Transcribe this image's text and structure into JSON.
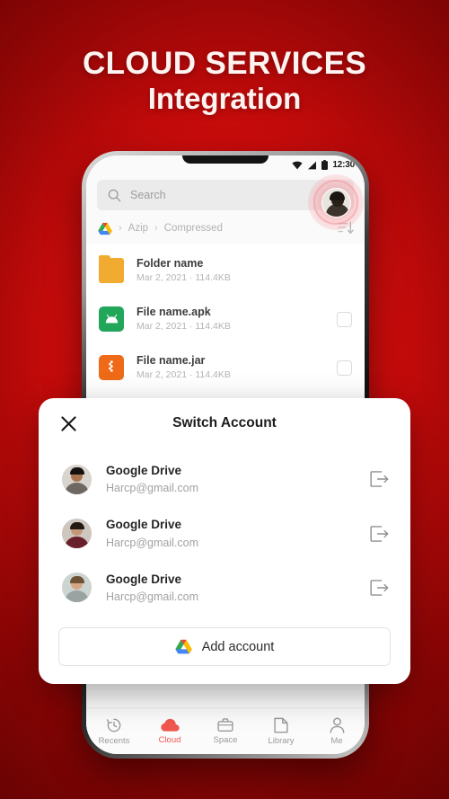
{
  "headline": {
    "line1": "CLOUD SERVICES",
    "line2": "Integration"
  },
  "colors": {
    "background_red": "#c40a0a",
    "accent_red": "#f0574f",
    "title_text": "#fdf4f2"
  },
  "phone": {
    "status_bar": {
      "time": "12:30",
      "icons": [
        "wifi-icon",
        "signal-icon",
        "battery-icon"
      ]
    },
    "search": {
      "placeholder": "Search",
      "value": "",
      "icon": "search-icon"
    },
    "avatar": {
      "icon": "user-avatar",
      "highlight": "tap-ring"
    },
    "breadcrumb": {
      "root_icon": "google-drive-icon",
      "items": [
        "Azip",
        "Compressed"
      ],
      "separator": "›",
      "sort_icon": "sort-descending-icon"
    },
    "files": [
      {
        "name": "Folder name",
        "meta": "Mar 2, 2021 · 114.4KB",
        "icon": "folder-icon",
        "icon_class": "ic-folder",
        "has_checkbox": false
      },
      {
        "name": "File name.apk",
        "meta": "Mar 2, 2021 · 114.4KB",
        "icon": "apk-file-icon",
        "icon_class": "ic-apk",
        "has_checkbox": true
      },
      {
        "name": "File name.jar",
        "meta": "Mar 2, 2021 · 114.4KB",
        "icon": "jar-file-icon",
        "icon_class": "ic-jar",
        "has_checkbox": true
      }
    ],
    "bottom_nav": [
      {
        "label": "Recents",
        "icon": "clock-history-icon",
        "active": false
      },
      {
        "label": "Cloud",
        "icon": "cloud-icon",
        "active": true
      },
      {
        "label": "Space",
        "icon": "briefcase-icon",
        "active": false
      },
      {
        "label": "Library",
        "icon": "document-icon",
        "active": false
      },
      {
        "label": "Me",
        "icon": "person-icon",
        "active": false
      }
    ]
  },
  "dialog": {
    "title": "Switch Account",
    "close_icon": "close-icon",
    "accounts": [
      {
        "name": "Google Drive",
        "email": "Harcp@gmail.com",
        "avatar_class": "av1",
        "signout_icon": "sign-out-icon"
      },
      {
        "name": "Google Drive",
        "email": "Harcp@gmail.com",
        "avatar_class": "av2",
        "signout_icon": "sign-out-icon"
      },
      {
        "name": "Google Drive",
        "email": "Harcp@gmail.com",
        "avatar_class": "av3",
        "signout_icon": "sign-out-icon"
      }
    ],
    "add_account": {
      "label": "Add account",
      "icon": "google-drive-icon"
    }
  }
}
